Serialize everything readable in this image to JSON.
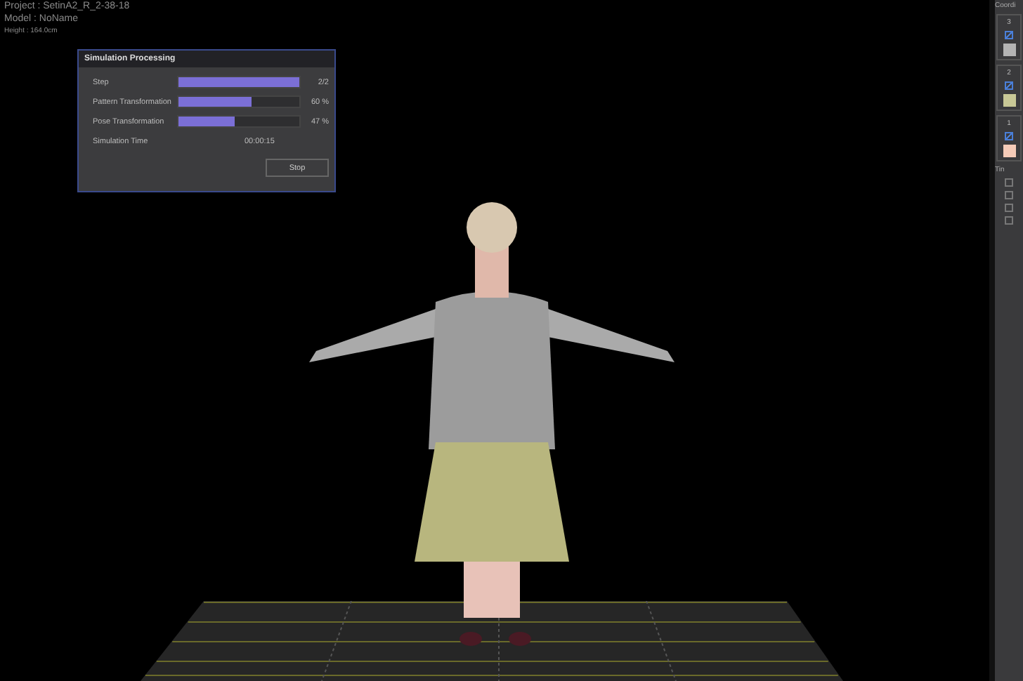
{
  "info": {
    "project": "Project : SetinA2_R_2-38-18",
    "model": "Model : NoName",
    "height": "Height : 164.0cm"
  },
  "dialog": {
    "title": "Simulation Processing",
    "rows": [
      {
        "label": "Step",
        "level": 1.0,
        "reading": "2/2"
      },
      {
        "label": "Pattern Transformation",
        "level": 0.6,
        "reading": "60 %"
      },
      {
        "label": "Pose Transformation",
        "level": 0.47,
        "reading": "47 %"
      }
    ],
    "time_label": "Simulation Time",
    "time_value": "00:00:15",
    "button": "Stop"
  },
  "side_panel": {
    "title": "Coordi",
    "layers": [
      {
        "number": "3",
        "checked": true,
        "color": "#b4b4b4"
      },
      {
        "number": "2",
        "checked": true,
        "color": "#c8c896"
      },
      {
        "number": "1",
        "checked": true,
        "color": "#f5cbb8"
      }
    ],
    "label": "Tin",
    "options": [
      {
        "checked": false
      },
      {
        "checked": false
      },
      {
        "checked": false
      },
      {
        "checked": false
      }
    ]
  }
}
